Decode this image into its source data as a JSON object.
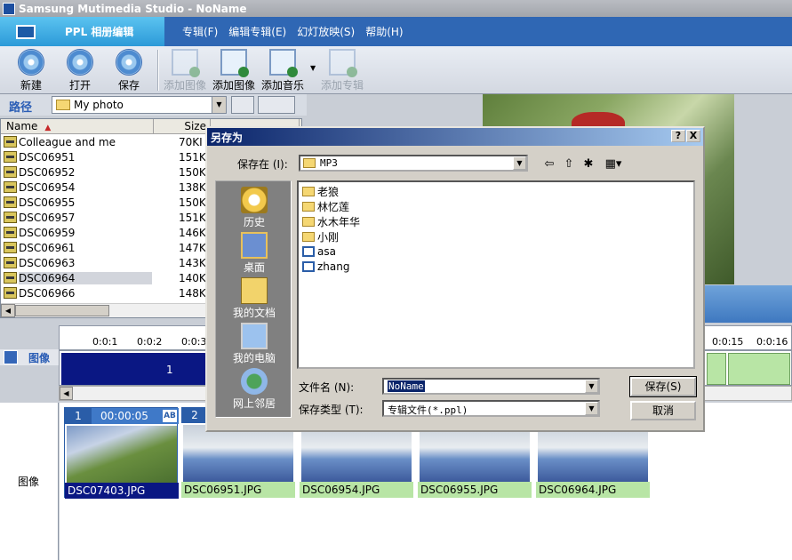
{
  "window": {
    "title": "Samsung Mutimedia Studio - NoName"
  },
  "nav": {
    "active_tab": "PPL 相册编辑",
    "menus": [
      "专辑(F)",
      "编辑专辑(E)",
      "幻灯放映(S)",
      "帮助(H)"
    ]
  },
  "toolbar": {
    "new": "新建",
    "open": "打开",
    "save": "保存",
    "add_image_disabled": "添加图像",
    "add_image": "添加图像",
    "add_music": "添加音乐",
    "add_album": "添加专辑"
  },
  "path": {
    "label": "路径",
    "folder": "My photo"
  },
  "filelist": {
    "columns": [
      "Name",
      "Size"
    ],
    "rows": [
      {
        "name": "Colleague and me",
        "size": "70KI"
      },
      {
        "name": "DSC06951",
        "size": "151KI"
      },
      {
        "name": "DSC06952",
        "size": "150KI"
      },
      {
        "name": "DSC06954",
        "size": "138KI"
      },
      {
        "name": "DSC06955",
        "size": "150KI"
      },
      {
        "name": "DSC06957",
        "size": "151KI"
      },
      {
        "name": "DSC06959",
        "size": "146KI"
      },
      {
        "name": "DSC06961",
        "size": "147KI"
      },
      {
        "name": "DSC06963",
        "size": "143KI"
      },
      {
        "name": "DSC06964",
        "size": "140KI"
      },
      {
        "name": "DSC06966",
        "size": "148KI"
      }
    ],
    "selected_index": 9
  },
  "timeline": {
    "ticks_left": [
      "0:0:1",
      "0:0:2",
      "0:0:3"
    ],
    "ticks_right": [
      "0:0:15",
      "0:0:16"
    ],
    "track_label": "图像",
    "clip_number": "1"
  },
  "storyboard": {
    "label": "图像",
    "items": [
      {
        "num": "1",
        "time": "00:00:05",
        "badge": "AB",
        "caption": "DSC07403.JPG",
        "selected": true
      },
      {
        "num": "2",
        "caption": "DSC06951.JPG"
      },
      {
        "caption": "DSC06954.JPG"
      },
      {
        "caption": "DSC06955.JPG"
      },
      {
        "caption": "DSC06964.JPG"
      }
    ]
  },
  "dialog": {
    "title": "另存为",
    "help_btn": "?",
    "close_btn": "X",
    "save_in_label": "保存在 (I):",
    "save_in_value": "MP3",
    "places": [
      "历史",
      "桌面",
      "我的文档",
      "我的电脑",
      "网上邻居"
    ],
    "items": [
      {
        "name": "老狼",
        "type": "folder"
      },
      {
        "name": "林忆莲",
        "type": "folder"
      },
      {
        "name": "水木年华",
        "type": "folder"
      },
      {
        "name": "小刚",
        "type": "folder"
      },
      {
        "name": "asa",
        "type": "file"
      },
      {
        "name": "zhang",
        "type": "file"
      }
    ],
    "filename_label": "文件名 (N):",
    "filename_value": "NoName",
    "filetype_label": "保存类型 (T):",
    "filetype_value": "专辑文件(*.ppl)",
    "save_button": "保存(S)",
    "cancel_button": "取消"
  }
}
